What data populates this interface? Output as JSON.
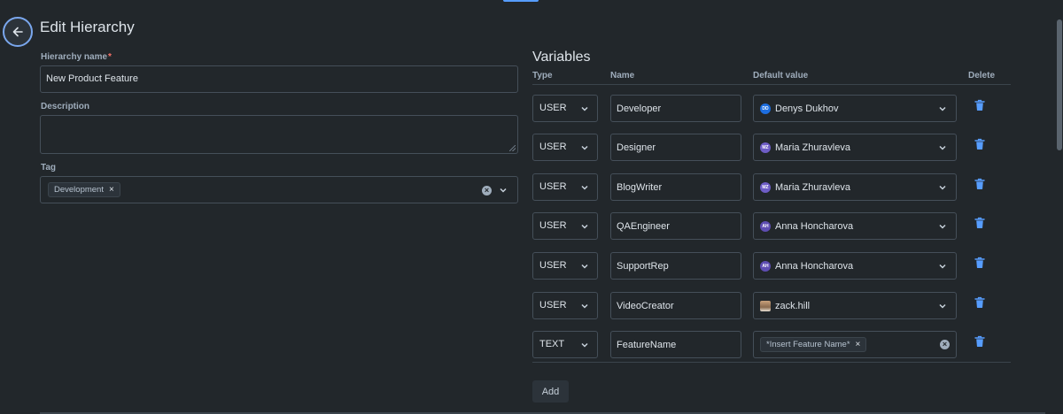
{
  "page": {
    "title": "Edit Hierarchy",
    "back_icon": "arrow-left-icon"
  },
  "form": {
    "hierarchy_name_label": "Hierarchy name",
    "required_marker": "*",
    "hierarchy_name_value": "New Product Feature",
    "description_label": "Description",
    "description_value": "",
    "tag_label": "Tag",
    "tags": [
      "Development"
    ],
    "chip_remove": "×"
  },
  "variables": {
    "title": "Variables",
    "columns": {
      "type": "Type",
      "name": "Name",
      "default": "Default value",
      "delete": "Delete"
    },
    "rows": [
      {
        "type": "USER",
        "name": "Developer",
        "default": "Denys Dukhov",
        "initials": "DD",
        "avatar_color": "#1d6ee0",
        "avatar_kind": "initials"
      },
      {
        "type": "USER",
        "name": "Designer",
        "default": "Maria Zhuravleva",
        "initials": "MZ",
        "avatar_color": "#6e5dc6",
        "avatar_kind": "initials"
      },
      {
        "type": "USER",
        "name": "BlogWriter",
        "default": "Maria Zhuravleva",
        "initials": "MZ",
        "avatar_color": "#6e5dc6",
        "avatar_kind": "initials"
      },
      {
        "type": "USER",
        "name": "QAEngineer",
        "default": "Anna Honcharova",
        "initials": "AH",
        "avatar_color": "#5e4db2",
        "avatar_kind": "initials"
      },
      {
        "type": "USER",
        "name": "SupportRep",
        "default": "Anna Honcharova",
        "initials": "AH",
        "avatar_color": "#5e4db2",
        "avatar_kind": "initials"
      },
      {
        "type": "USER",
        "name": "VideoCreator",
        "default": "zack.hill",
        "initials": "",
        "avatar_color": "#8a6a4e",
        "avatar_kind": "photo"
      },
      {
        "type": "TEXT",
        "name": "FeatureName",
        "default": "*Insert Feature Name*",
        "initials": "",
        "avatar_color": "",
        "avatar_kind": "chip"
      }
    ],
    "add_label": "Add"
  },
  "colors": {
    "background": "#22272b",
    "accent": "#579dff",
    "delete_icon": "#579dff",
    "required": "#f87168"
  }
}
